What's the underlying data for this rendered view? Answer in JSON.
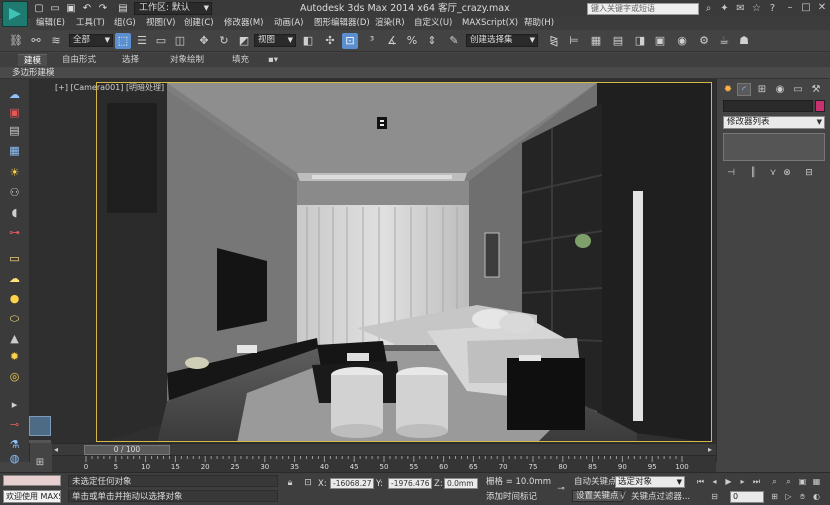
{
  "titlebar": {
    "workspace": "工作区: 默认",
    "title": "Autodesk 3ds Max  2014 x64      客厅_crazy.max",
    "search_placeholder": "键入关键字或短语"
  },
  "menu": [
    "编辑(E)",
    "工具(T)",
    "组(G)",
    "视图(V)",
    "创建(C)",
    "修改器(M)",
    "动画(A)",
    "图形编辑器(D)",
    "渲染(R)",
    "自定义(U)",
    "MAXScript(X)",
    "帮助(H)"
  ],
  "toolbar": {
    "selection_filter": "全部",
    "reference_coord": "视图",
    "named_selection": "创建选择集"
  },
  "ribbon": {
    "tabs": [
      "建模",
      "自由形式",
      "选择",
      "对象绘制",
      "填充"
    ],
    "active_tab": "建模",
    "panel_label": "多边形建模"
  },
  "viewport": {
    "label": "[+] [Camera001] [明暗处理]"
  },
  "command_panel": {
    "modifier_list": "修改器列表",
    "color": "#c8306e"
  },
  "timeline": {
    "frame_indicator": "0 / 100",
    "ticks": [
      "0",
      "5",
      "10",
      "15",
      "20",
      "25",
      "30",
      "35",
      "40",
      "45",
      "50",
      "55",
      "60",
      "65",
      "70",
      "75",
      "80",
      "85",
      "90",
      "95",
      "100"
    ]
  },
  "status": {
    "welcome": "欢迎使用 MAXSc",
    "line1": "未选定任何对象",
    "line2": "单击或单击并拖动以选择对象",
    "x_label": "X:",
    "x_value": "-16068.27",
    "y_label": "Y:",
    "y_value": "-1976.476",
    "z_label": "Z:",
    "z_value": "0.0mm",
    "grid": "栅格 = 10.0mm",
    "add_time_tag": "添加时间标记",
    "auto_key": "自动关键点",
    "set_key": "设置关键点",
    "selected_object": "选定对象",
    "key_filters": "关键点过滤器...",
    "current_frame": "0"
  }
}
